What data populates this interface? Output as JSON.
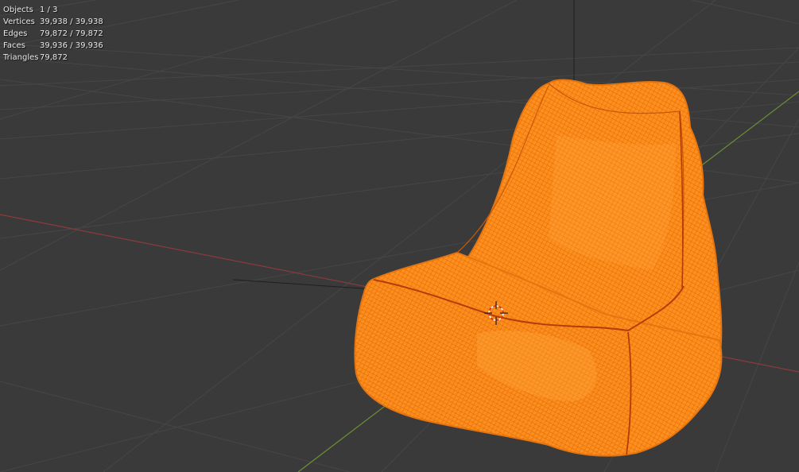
{
  "viewport": {
    "statistics": [
      {
        "label": "Objects",
        "value": "1 / 3"
      },
      {
        "label": "Vertices",
        "value": "39,938 / 39,938"
      },
      {
        "label": "Edges",
        "value": "79,872 / 79,872"
      },
      {
        "label": "Faces",
        "value": "39,936 / 39,936"
      },
      {
        "label": "Triangles",
        "value": "79,872"
      }
    ],
    "colors": {
      "background": "#3a3a3a",
      "grid": "#444444",
      "x_axis": "#8b3a3f",
      "y_axis": "#6b8e34",
      "selection": "#ff8c14",
      "mesh_wire": "#d9640a"
    },
    "icons": [
      "3d-cursor-icon"
    ]
  }
}
